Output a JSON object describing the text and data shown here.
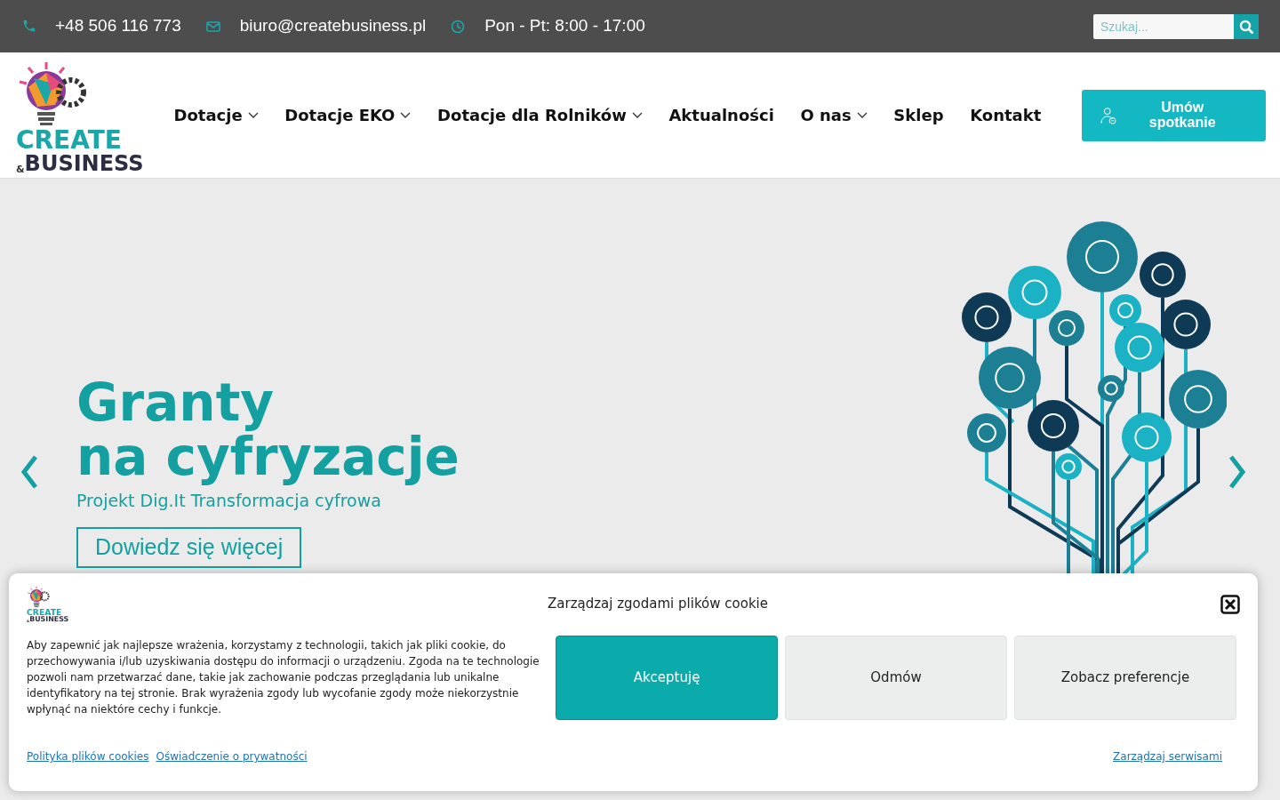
{
  "topbar": {
    "contacts": [
      {
        "kind": "phone",
        "text": "+48 506 116 773"
      },
      {
        "kind": "mail",
        "text": "biuro@createbusiness.pl"
      },
      {
        "kind": "clock",
        "text": "Pon - Pt: 8:00 - 17:00"
      }
    ],
    "search": {
      "placeholder": "Szukaj..."
    }
  },
  "logo": {
    "line1": "CREATE",
    "amp": "&",
    "line2": "BUSINESS"
  },
  "nav": {
    "items": [
      {
        "label": "Dotacje",
        "dropdown": true
      },
      {
        "label": "Dotacje EKO",
        "dropdown": true
      },
      {
        "label": "Dotacje dla Rolników",
        "dropdown": true
      },
      {
        "label": "Aktualności",
        "dropdown": false
      },
      {
        "label": "O nas",
        "dropdown": true
      },
      {
        "label": "Sklep",
        "dropdown": false
      },
      {
        "label": "Kontakt",
        "dropdown": false
      }
    ],
    "cta": "Umów spotkanie"
  },
  "hero": {
    "title_line1": "Granty",
    "title_line2": "na cyfryzacje",
    "subtitle": "Projekt Dig.It Transformacja cyfrowa",
    "button": "Dowiedz się więcej"
  },
  "cookie_banner": {
    "title": "Zarządzaj zgodami plików cookie",
    "logo": {
      "line1": "CREATE",
      "amp": "&",
      "line2": "BUSINESS"
    },
    "text": "Aby zapewnić jak najlepsze wrażenia, korzystamy z technologii, takich jak pliki cookie, do przechowywania i/lub uzyskiwania dostępu do informacji o urządzeniu. Zgoda na te technologie pozwoli nam przetwarzać dane, takie jak zachowanie podczas przeglądania lub unikalne identyfikatory na tej stronie. Brak wyrażenia zgody lub wycofanie zgody może niekorzystnie wpłynąć na niektóre cechy i funkcje.",
    "buttons": [
      {
        "label": "Akceptuję",
        "kind": "primary"
      },
      {
        "label": "Odmów",
        "kind": "secondary"
      },
      {
        "label": "Zobacz preferencje",
        "kind": "secondary"
      }
    ],
    "links": [
      "Polityka plików cookies",
      "Oświadczenie o prywatności"
    ],
    "manage_link": "Zarządzaj serwisami"
  }
}
